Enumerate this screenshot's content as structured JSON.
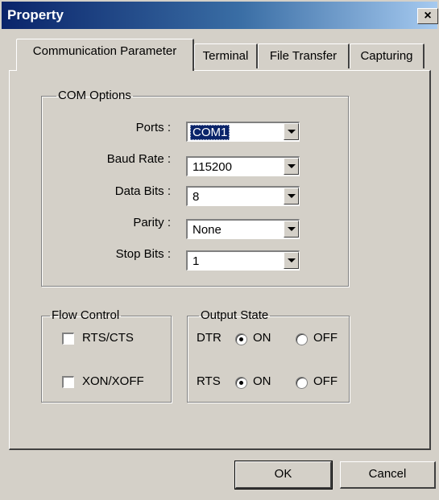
{
  "window": {
    "title": "Property",
    "close_label": "×"
  },
  "tabs": [
    {
      "label": "Communication Parameter",
      "active": true
    },
    {
      "label": "Terminal",
      "active": false
    },
    {
      "label": "File Transfer",
      "active": false
    },
    {
      "label": "Capturing",
      "active": false
    }
  ],
  "com_options": {
    "legend": "COM Options",
    "fields": [
      {
        "label": "Ports :",
        "value": "COM1"
      },
      {
        "label": "Baud Rate :",
        "value": "115200"
      },
      {
        "label": "Data Bits :",
        "value": "8"
      },
      {
        "label": "Parity :",
        "value": "None"
      },
      {
        "label": "Stop Bits :",
        "value": "1"
      }
    ]
  },
  "flow_control": {
    "legend": "Flow Control",
    "items": [
      {
        "label": "RTS/CTS",
        "checked": false
      },
      {
        "label": "XON/XOFF",
        "checked": false
      }
    ]
  },
  "output_state": {
    "legend": "Output State",
    "rows": [
      {
        "label": "DTR",
        "on_label": "ON",
        "off_label": "OFF",
        "selected": "ON"
      },
      {
        "label": "RTS",
        "on_label": "ON",
        "off_label": "OFF",
        "selected": "ON"
      }
    ]
  },
  "buttons": {
    "ok": "OK",
    "cancel": "Cancel"
  },
  "colors": {
    "titlebar_start": "#0a246a",
    "titlebar_end": "#a6caf0",
    "face": "#d4d0c8",
    "selection": "#0a246a"
  }
}
